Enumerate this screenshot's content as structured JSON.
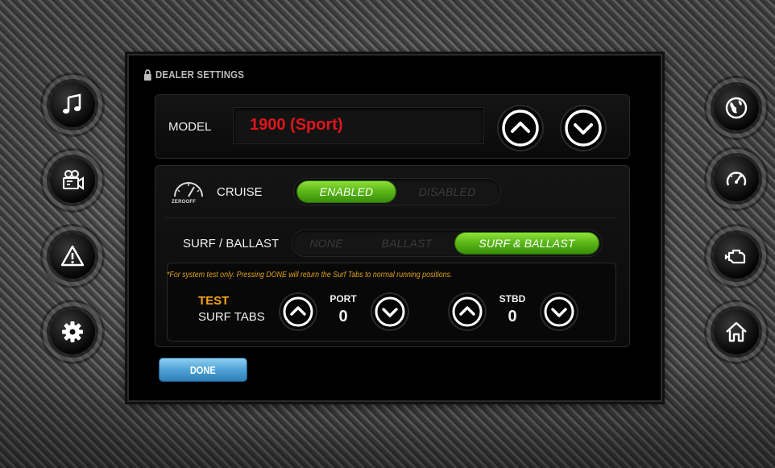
{
  "panel": {
    "title": "DEALER SETTINGS",
    "title_icon": "lock-icon"
  },
  "model": {
    "label": "MODEL",
    "value": "1900 (Sport)",
    "value_color": "#e0151b",
    "up_icon": "chevron-up-circle-icon",
    "down_icon": "chevron-down-circle-icon"
  },
  "cruise": {
    "icon": "zero-off-gauge-icon",
    "icon_caption": "ZEROOFF",
    "label": "CRUISE",
    "options": [
      "ENABLED",
      "DISABLED"
    ],
    "selected": "ENABLED"
  },
  "surf_ballast": {
    "label": "SURF / BALLAST",
    "options": [
      "NONE",
      "BALLAST",
      "SURF & BALLAST"
    ],
    "selected": "SURF & BALLAST"
  },
  "test": {
    "note": "*For system test only. Pressing DONE will return the Surf Tabs to normal running positions.",
    "title": "TEST",
    "subtitle": "SURF TABS",
    "port": {
      "label": "PORT",
      "value": "0"
    },
    "stbd": {
      "label": "STBD",
      "value": "0"
    }
  },
  "done_label": "DONE",
  "left_nav": [
    "music-note-icon",
    "video-camera-icon",
    "warning-triangle-icon",
    "gear-icon"
  ],
  "right_nav": [
    "globe-icon",
    "speedometer-icon",
    "engine-icon",
    "home-icon"
  ],
  "colors": {
    "accent_green": "#58b516",
    "accent_orange": "#e2a21a",
    "done_blue": "#4fa2d6",
    "model_red": "#e0151b"
  }
}
